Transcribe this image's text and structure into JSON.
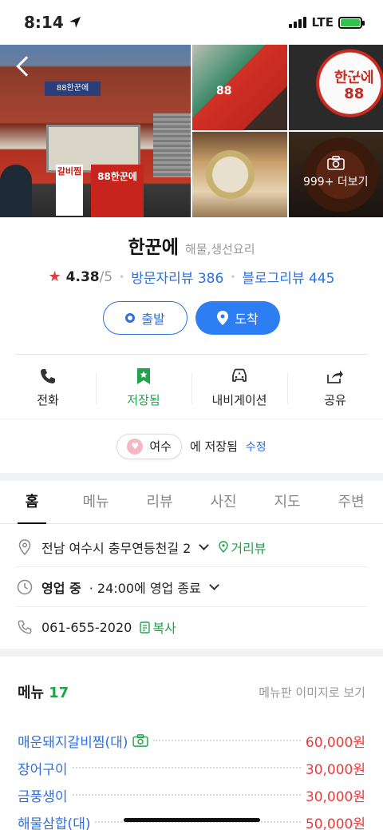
{
  "status": {
    "time": "8:14",
    "network": "LTE"
  },
  "photos": {
    "more_label": "999+ 더보기",
    "main_board": "88한꾼에",
    "main_vertical": "갈비찜",
    "main_topsign": "88한꾼에",
    "tile1_label": "88",
    "tile2_label": "한꾼에 88"
  },
  "place": {
    "name": "한꾼에",
    "category": "해물,생선요리",
    "rating": "4.38",
    "rating_max": "/5",
    "visitor_review": "방문자리뷰 386",
    "blog_review": "블로그리뷰 445",
    "depart_label": "출발",
    "arrive_label": "도착"
  },
  "actions": {
    "call": "전화",
    "saved": "저장됨",
    "navigation": "내비게이션",
    "share": "공유"
  },
  "savebar": {
    "folder": "여수",
    "saved_text": "에 저장됨",
    "edit": "수정"
  },
  "tabs": [
    "홈",
    "메뉴",
    "리뷰",
    "사진",
    "지도",
    "주변"
  ],
  "details": {
    "address": "전남 여수시 충무연등천길 2",
    "street_view": "거리뷰",
    "hours_status": "영업 중",
    "hours_text": "· 24:00에 영업 종료",
    "phone": "061-655-2020",
    "copy": "복사"
  },
  "menu": {
    "title": "메뉴",
    "count": "17",
    "image_link": "메뉴판 이미지로 보기",
    "items": [
      {
        "name": "매운돼지갈비찜(대)",
        "price": "60,000원",
        "has_photo": true
      },
      {
        "name": "장어구이",
        "price": "30,000원"
      },
      {
        "name": "금풍생이",
        "price": "30,000원"
      },
      {
        "name": "해물삼합(대)",
        "price": "50,000원"
      }
    ]
  },
  "colors": {
    "accent": "#2c6fe0",
    "green": "#20a34a",
    "price": "#ea3b3b",
    "star": "#ea3b3b"
  }
}
